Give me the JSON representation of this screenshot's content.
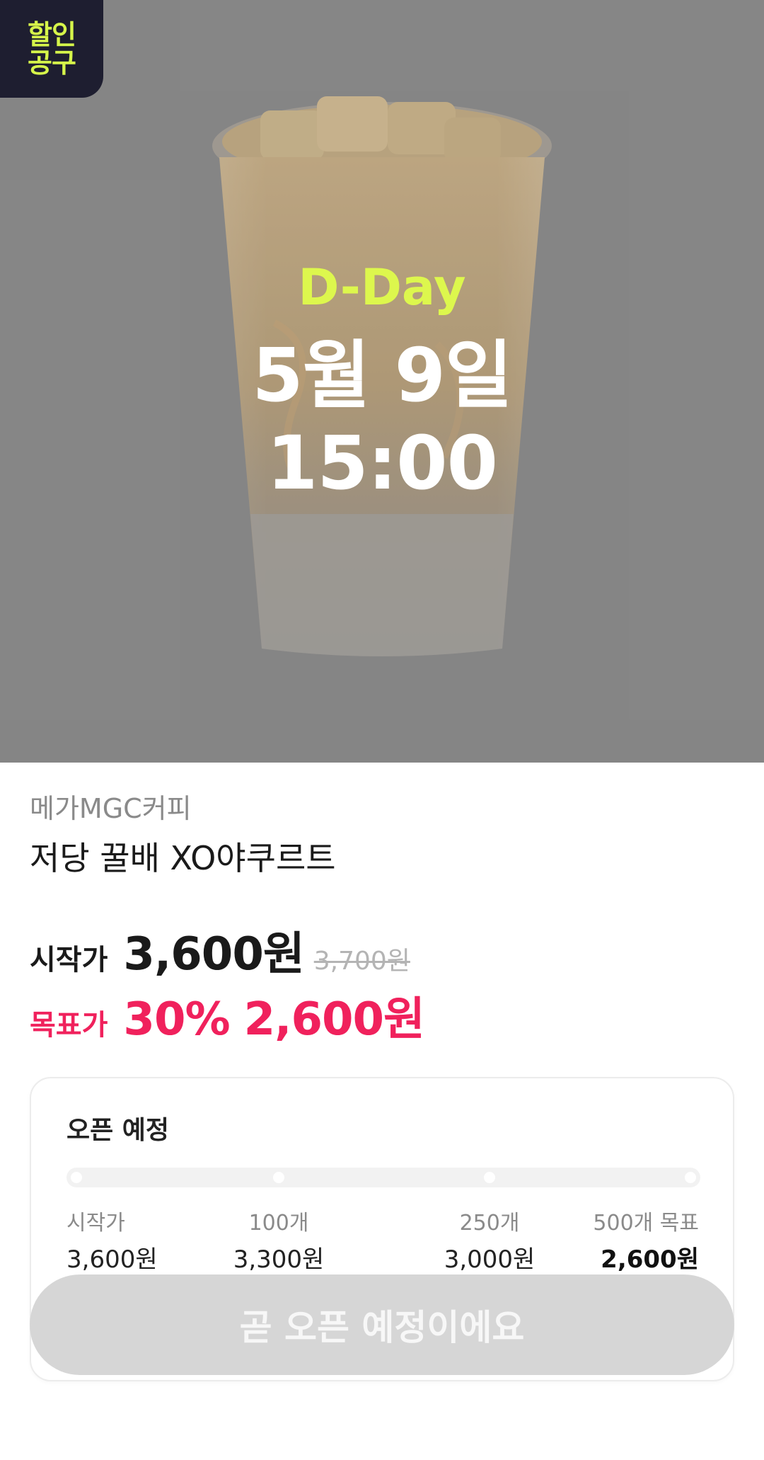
{
  "hero": {
    "badge_line1": "할인",
    "badge_line2": "공구",
    "dday": "D-Day",
    "date": "5월 9일",
    "time": "15:00"
  },
  "product": {
    "brand": "메가MGC커피",
    "name": "저당 꿀배 XO야쿠르트"
  },
  "pricing": {
    "start_label": "시작가",
    "start_price": "3,600원",
    "original_price": "3,700원",
    "target_label": "목표가",
    "target_discount": "30%",
    "target_price": "2,600원"
  },
  "progress": {
    "title": "오픈 예정",
    "steps": [
      {
        "label": "시작가",
        "price": "3,600원"
      },
      {
        "label": "100개",
        "price": "3,300원"
      },
      {
        "label": "250개",
        "price": "3,000원"
      },
      {
        "label": "500개 목표",
        "price": "2,600원"
      }
    ]
  },
  "cta": {
    "label": "곧 오픈 예정이에요"
  },
  "colors": {
    "accent_pink": "#f0215c",
    "lime": "#ddf74d",
    "badge_bg": "#1e1e30",
    "cta_disabled": "#d6d6d6"
  }
}
